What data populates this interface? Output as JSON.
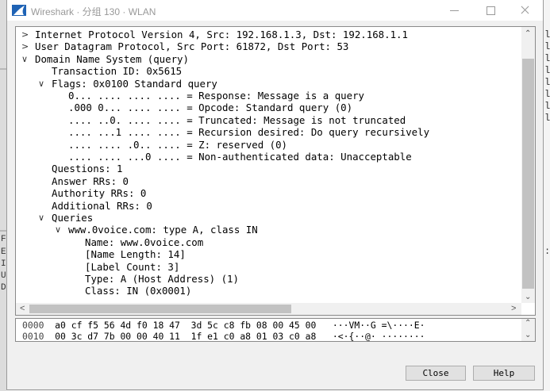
{
  "window": {
    "title": "Wireshark · 分组 130 · WLAN",
    "controls": [
      "minimize",
      "maximize",
      "close"
    ]
  },
  "tree": [
    {
      "toggle": ">",
      "text": "Internet Protocol Version 4, Src: 192.168.1.3, Dst: 192.168.1.1"
    },
    {
      "toggle": ">",
      "text": "User Datagram Protocol, Src Port: 61872, Dst Port: 53"
    },
    {
      "toggle": "v",
      "text": "Domain Name System (query)"
    },
    {
      "toggle": "",
      "text": "Transaction ID: 0x5615"
    },
    {
      "toggle": "v",
      "text": "Flags: 0x0100 Standard query"
    },
    {
      "toggle": "",
      "text": "0... .... .... .... = Response: Message is a query"
    },
    {
      "toggle": "",
      "text": ".000 0... .... .... = Opcode: Standard query (0)"
    },
    {
      "toggle": "",
      "text": ".... ..0. .... .... = Truncated: Message is not truncated"
    },
    {
      "toggle": "",
      "text": ".... ...1 .... .... = Recursion desired: Do query recursively"
    },
    {
      "toggle": "",
      "text": ".... .... .0.. .... = Z: reserved (0)"
    },
    {
      "toggle": "",
      "text": ".... .... ...0 .... = Non-authenticated data: Unacceptable"
    },
    {
      "toggle": "",
      "text": "Questions: 1"
    },
    {
      "toggle": "",
      "text": "Answer RRs: 0"
    },
    {
      "toggle": "",
      "text": "Authority RRs: 0"
    },
    {
      "toggle": "",
      "text": "Additional RRs: 0"
    },
    {
      "toggle": "v",
      "text": "Queries"
    },
    {
      "toggle": "v",
      "text": "www.0voice.com: type A, class IN"
    },
    {
      "toggle": "",
      "text": "Name: www.0voice.com"
    },
    {
      "toggle": "",
      "text": "[Name Length: 14]"
    },
    {
      "toggle": "",
      "text": "[Label Count: 3]"
    },
    {
      "toggle": "",
      "text": "Type: A (Host Address) (1)"
    },
    {
      "toggle": "",
      "text": "Class: IN (0x0001)"
    }
  ],
  "hex": [
    {
      "offset": "0000",
      "bytes": "a0 cf f5 56 4d f0 18 47  3d 5c c8 fb 08 00 45 00",
      "ascii": "···VM··G =\\····E·"
    },
    {
      "offset": "0010",
      "bytes": "00 3c d7 7b 00 00 40 11  1f e1 c0 a8 01 03 c0 a8",
      "ascii": "·<·{··@· ········"
    }
  ],
  "buttons": {
    "close": "Close",
    "help": "Help"
  },
  "background": {
    "right_letters": [
      "la",
      "la",
      "la",
      "la",
      "la",
      "la",
      "la",
      "la"
    ],
    "right_colon": ":",
    "left_letters": [
      "F",
      "E",
      "I",
      "U",
      "D"
    ]
  }
}
